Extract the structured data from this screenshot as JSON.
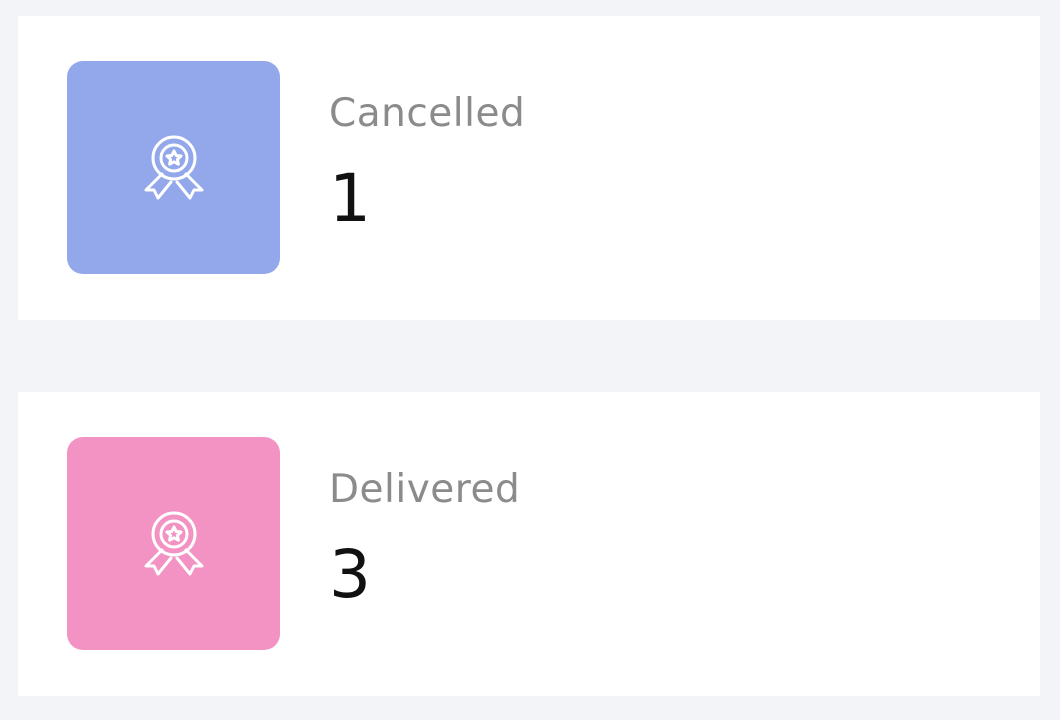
{
  "stats": [
    {
      "label": "Cancelled",
      "value": "1",
      "icon": "award-ribbon-icon",
      "tile_color": "#93a7eb"
    },
    {
      "label": "Delivered",
      "value": "3",
      "icon": "award-ribbon-icon",
      "tile_color": "#f293c3"
    }
  ]
}
